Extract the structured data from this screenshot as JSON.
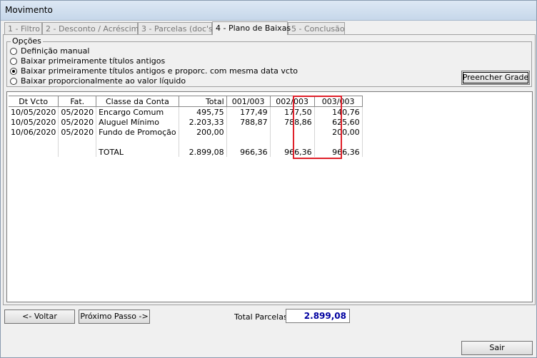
{
  "window": {
    "title": "Movimento"
  },
  "tabs": [
    {
      "label": "1 - Filtro",
      "active": false
    },
    {
      "label": "2 - Desconto / Acréscimo",
      "active": false
    },
    {
      "label": "3 - Parcelas (doc's)",
      "active": false
    },
    {
      "label": "4 - Plano de Baixas",
      "active": true
    },
    {
      "label": "5 - Conclusão",
      "active": false
    }
  ],
  "options": {
    "legend": "Opções",
    "items": [
      {
        "label": "Definição manual",
        "checked": false
      },
      {
        "label": "Baixar primeiramente títulos antigos",
        "checked": false
      },
      {
        "label": "Baixar primeiramente títulos antigos e proporc. com mesma data vcto",
        "checked": true
      },
      {
        "label": "Baixar proporcionalmente ao valor líquido",
        "checked": false
      }
    ]
  },
  "buttons": {
    "fill_grid": "Preencher Grade",
    "back": "<- Voltar",
    "next": "Próximo Passo ->",
    "exit": "Sair"
  },
  "grid": {
    "columns": [
      "Dt Vcto",
      "Fat.",
      "Classe da Conta",
      "Total",
      "001/003",
      "002/003",
      "003/003"
    ],
    "rows": [
      [
        "10/05/2020",
        "05/2020",
        "Encargo Comum",
        "495,75",
        "177,49",
        "177,50",
        "140,76"
      ],
      [
        "10/05/2020",
        "05/2020",
        "Aluguel Mínimo",
        "2.203,33",
        "788,87",
        "788,86",
        "625,60"
      ],
      [
        "10/06/2020",
        "05/2020",
        "Fundo de Promoção",
        "200,00",
        "",
        "",
        "200,00"
      ],
      [
        "",
        "",
        "",
        "",
        "",
        "",
        ""
      ],
      [
        "",
        "",
        "TOTAL",
        "2.899,08",
        "966,36",
        "966,36",
        "966,36"
      ]
    ]
  },
  "total_parcelas": {
    "label": "Total Parcelas",
    "value": "2.899,08"
  }
}
